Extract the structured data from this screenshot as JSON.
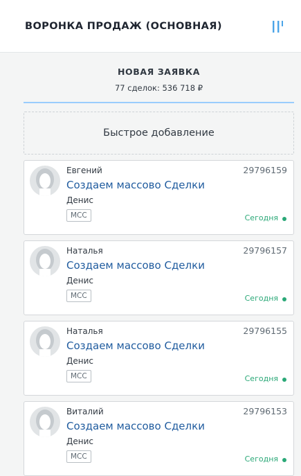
{
  "header": {
    "title": "ВОРОНКА ПРОДАЖ (ОСНОВНАЯ)",
    "filter_icon": "sliders-icon",
    "accent_color": "#4aa4e8"
  },
  "column": {
    "name": "НОВАЯ ЗАЯВКА",
    "summary": "77 сделок: 536 718 ₽",
    "underline_color": "#99ccfd"
  },
  "quick_add": {
    "label": "Быстрое добавление"
  },
  "cards": [
    {
      "contact": "Евгений",
      "id": "29796159",
      "deal": "Создаем массово Сделки",
      "responsible": "Денис",
      "tag": "МСС",
      "date": "Сегодня"
    },
    {
      "contact": "Наталья",
      "id": "29796157",
      "deal": "Создаем массово Сделки",
      "responsible": "Денис",
      "tag": "МСС",
      "date": "Сегодня"
    },
    {
      "contact": "Наталья",
      "id": "29796155",
      "deal": "Создаем массово Сделки",
      "responsible": "Денис",
      "tag": "МСС",
      "date": "Сегодня"
    },
    {
      "contact": "Виталий",
      "id": "29796153",
      "deal": "Создаем массово Сделки",
      "responsible": "Денис",
      "tag": "МСС",
      "date": "Сегодня"
    }
  ],
  "colors": {
    "link": "#1f5b9e",
    "status_green": "#2aa877"
  }
}
